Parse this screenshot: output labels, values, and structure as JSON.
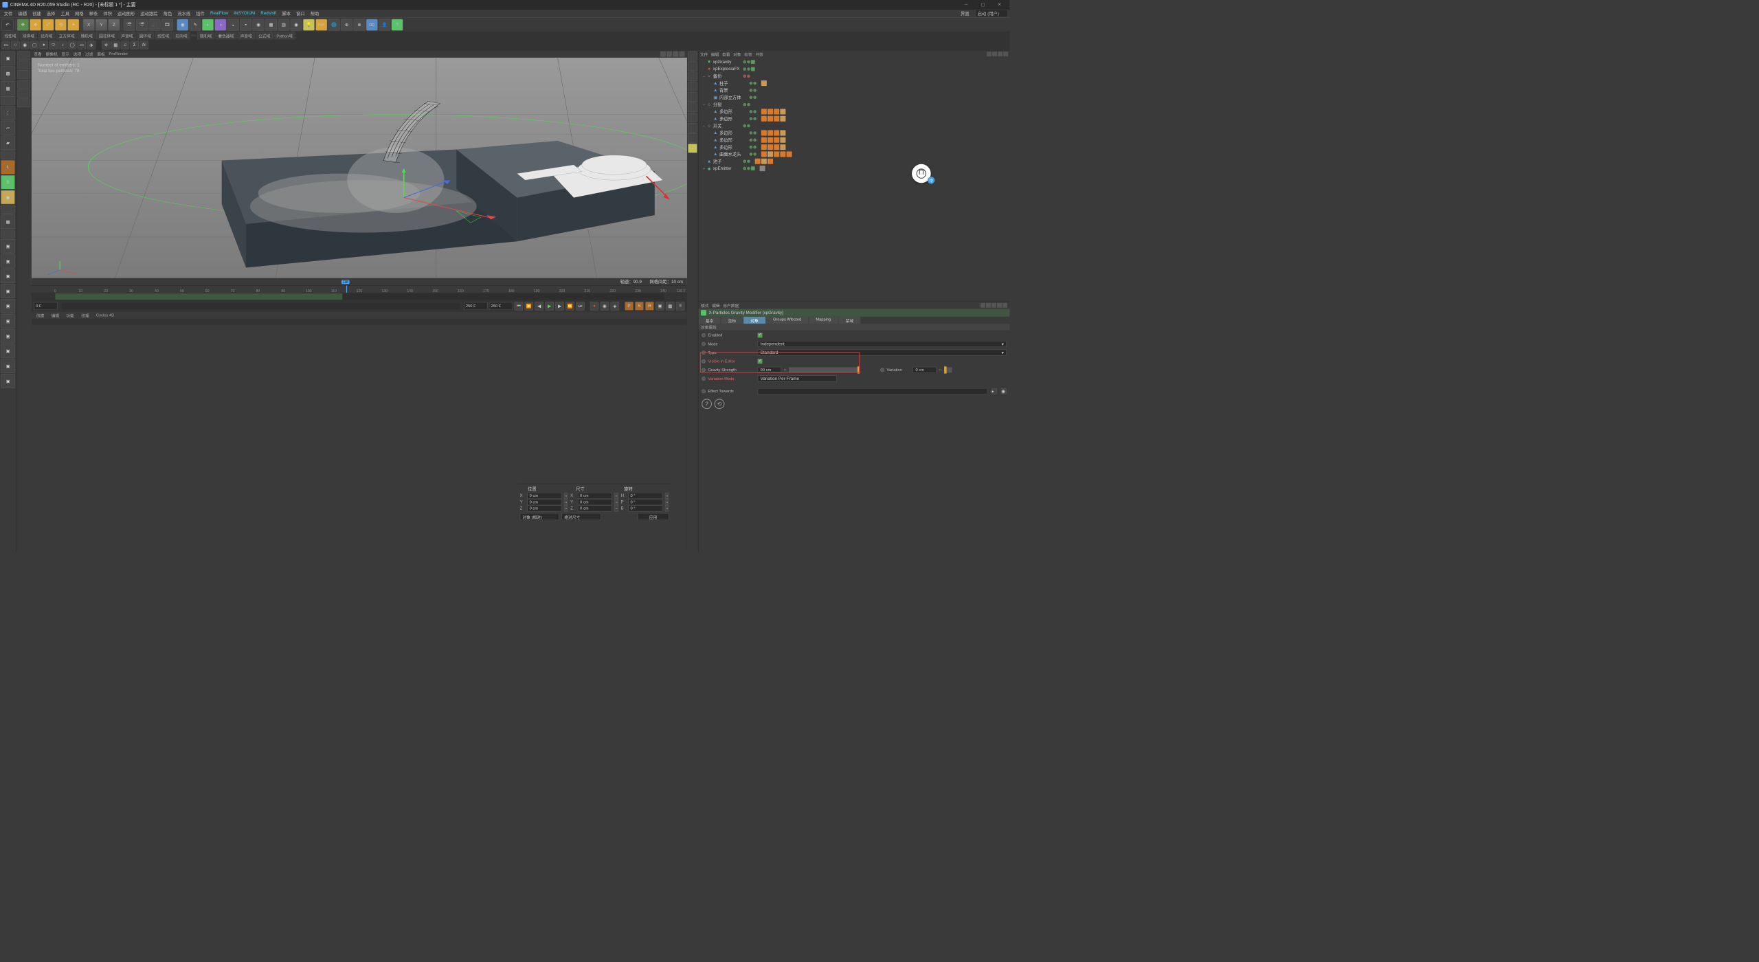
{
  "app": {
    "title": "CINEMA 4D R20.059 Studio (RC - R20) - [未标题 1 *] - 主要",
    "layout_label": "界面",
    "layout_value": "启动 (用户)"
  },
  "menu": {
    "items": [
      "文件",
      "编辑",
      "创建",
      "选择",
      "工具",
      "网格",
      "样条",
      "体积",
      "运动图形",
      "运动跟踪",
      "角色",
      "流水线",
      "插件",
      "RealFlow",
      "INSYDIUM",
      "Redshift",
      "脚本",
      "窗口",
      "帮助"
    ]
  },
  "toolbar_tabs": [
    "线性域",
    "球体域",
    "径向域",
    "立方体域",
    "随机域",
    "圆柱体域",
    "声音域",
    "圆环域",
    "线性域",
    "形向域",
    "随机域",
    "着色器域",
    "声音域",
    "公式域",
    "Python域"
  ],
  "view_menu": [
    "查看",
    "摄像机",
    "显示",
    "选项",
    "过滤",
    "面板",
    "ProRender"
  ],
  "hud": {
    "emitters_label": "Number of emitters:",
    "emitters_value": "1",
    "particles_label": "Total live particles:",
    "particles_value": "78"
  },
  "viewport_status": {
    "left_label": "轴速：",
    "left_value": "90.9",
    "right_label": "网格间距：",
    "right_value": "10 cm"
  },
  "timeline": {
    "ticks": [
      0,
      10,
      20,
      30,
      40,
      50,
      60,
      70,
      80,
      90,
      100,
      110,
      120,
      130,
      140,
      150,
      160,
      170,
      180,
      190,
      200,
      210,
      220,
      230,
      240
    ],
    "current": 118,
    "start": "0 F",
    "end": "250 F",
    "range_end": "250 F",
    "playhead_label": "118",
    "right_label": "116 F"
  },
  "bottom_tabs": [
    "创建",
    "编辑",
    "功能",
    "纹理",
    "Cycles 4D"
  ],
  "coord": {
    "headers": [
      "位置",
      "尺寸",
      "旋转"
    ],
    "rows": [
      {
        "axis": "X",
        "pos": "0 cm",
        "size": "0 cm",
        "rot": "0 °"
      },
      {
        "axis": "Y",
        "pos": "0 cm",
        "size": "0 cm",
        "rot": "0 °"
      },
      {
        "axis": "Z",
        "pos": "0 cm",
        "size": "0 cm",
        "rot": "0 °"
      }
    ],
    "mode1": "对象 (相对)",
    "mode2": "绝对尺寸",
    "apply": "应用"
  },
  "obj_panel": {
    "tabs": [
      "文件",
      "编辑",
      "查看",
      "对象",
      "标签",
      "书签"
    ]
  },
  "objects": [
    {
      "depth": 0,
      "exp": "",
      "icon": "grav",
      "name": "xpGravity",
      "dots": [
        "g",
        "g"
      ],
      "chk": true,
      "tags": []
    },
    {
      "depth": 0,
      "exp": "",
      "icon": "efx",
      "name": "xpExplosiaFX",
      "dots": [
        "g",
        "g"
      ],
      "chk": true,
      "tags": []
    },
    {
      "depth": 0,
      "exp": "–",
      "icon": "null",
      "name": "备份",
      "dots": [
        "r",
        "r"
      ],
      "chk": false,
      "tags": []
    },
    {
      "depth": 1,
      "exp": "",
      "icon": "obj",
      "name": "柱子",
      "dots": [
        "g",
        "g"
      ],
      "chk": false,
      "tags": [
        "tex"
      ]
    },
    {
      "depth": 1,
      "exp": "",
      "icon": "obj",
      "name": "背景",
      "dots": [
        "g",
        "g"
      ],
      "chk": false,
      "tags": []
    },
    {
      "depth": 1,
      "exp": "",
      "icon": "cube",
      "name": "内部立方体",
      "dots": [
        "g",
        "g"
      ],
      "chk": false,
      "tags": []
    },
    {
      "depth": 0,
      "exp": "–",
      "icon": "null",
      "name": "分裂",
      "dots": [
        "g",
        "g"
      ],
      "chk": false,
      "tags": []
    },
    {
      "depth": 1,
      "exp": "",
      "icon": "poly",
      "name": "多边形",
      "dots": [
        "g",
        "g"
      ],
      "chk": false,
      "tags": [
        "t",
        "t",
        "t",
        "tex"
      ]
    },
    {
      "depth": 1,
      "exp": "",
      "icon": "poly",
      "name": "多边形",
      "dots": [
        "g",
        "g"
      ],
      "chk": false,
      "tags": [
        "t",
        "t",
        "t",
        "tex"
      ]
    },
    {
      "depth": 0,
      "exp": "–",
      "icon": "null",
      "name": "开关",
      "dots": [
        "g",
        "g"
      ],
      "chk": false,
      "tags": []
    },
    {
      "depth": 1,
      "exp": "",
      "icon": "poly",
      "name": "多边形",
      "dots": [
        "g",
        "g"
      ],
      "chk": false,
      "tags": [
        "t",
        "t",
        "t",
        "tex"
      ]
    },
    {
      "depth": 1,
      "exp": "",
      "icon": "poly",
      "name": "多边形",
      "dots": [
        "g",
        "g"
      ],
      "chk": false,
      "tags": [
        "t",
        "t",
        "t",
        "tex"
      ]
    },
    {
      "depth": 1,
      "exp": "",
      "icon": "poly",
      "name": "多边形",
      "dots": [
        "g",
        "g"
      ],
      "chk": false,
      "tags": [
        "t",
        "t",
        "t",
        "tex"
      ]
    },
    {
      "depth": 1,
      "exp": "",
      "icon": "obj",
      "name": "曲面水龙头",
      "dots": [
        "g",
        "g"
      ],
      "chk": false,
      "tags": [
        "o",
        "tex",
        "o",
        "t",
        "t"
      ]
    },
    {
      "depth": 0,
      "exp": "",
      "icon": "obj",
      "name": "池子",
      "dots": [
        "g",
        "g"
      ],
      "chk": false,
      "tags": [
        "o",
        "tex",
        "o"
      ]
    },
    {
      "depth": 0,
      "exp": "+",
      "icon": "emit",
      "name": "xpEmitter",
      "dots": [
        "g",
        "g"
      ],
      "chk": true,
      "tags": [
        "c"
      ]
    }
  ],
  "attr_panel": {
    "tabs_head": [
      "模式",
      "编辑",
      "用户数据"
    ],
    "title": "X-Particles Gravity Modifier [xpGravity]",
    "tabs": [
      "基本",
      "坐标",
      "对象",
      "Groups Affected",
      "Mapping",
      "禁域"
    ],
    "active_tab": 2,
    "section": "对象属性",
    "enabled_label": "Enabled",
    "mode_label": "Mode",
    "mode_value": "Independent",
    "type_label": "Type",
    "type_value": "Standard",
    "visible_label": "Visible in Editor",
    "strength_label": "Gravity Strength",
    "strength_value": "90 cm",
    "variation_label": "Variation",
    "variation_value": "0 cm",
    "varmode_label": "Variation Mode",
    "varmode_value": "Variation Per-Frame",
    "effect_label": "Effect Towards"
  }
}
